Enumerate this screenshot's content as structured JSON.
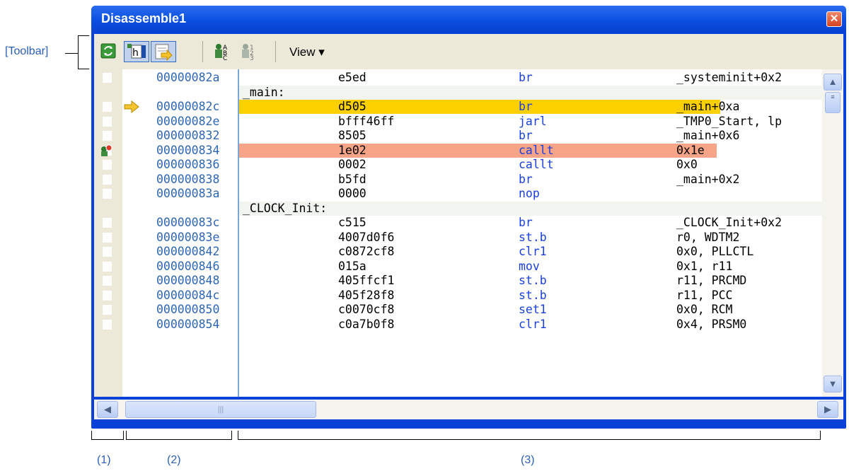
{
  "annotations": {
    "toolbar_label": "[Toolbar]",
    "area1": "(1)",
    "area2": "(2)",
    "area3": "(3)"
  },
  "window": {
    "title": "Disassemble1",
    "close_glyph": "✕"
  },
  "toolbar": {
    "buttons": [
      {
        "icon": "refresh-icon",
        "pressed": false
      },
      {
        "icon": "mixed-display-icon",
        "pressed": true
      },
      {
        "icon": "go-to-pc-icon",
        "pressed": true
      },
      {
        "icon": "symbol-display-icon",
        "pressed": false
      },
      {
        "icon": "number-display-icon",
        "pressed": false
      }
    ],
    "view_label": "View",
    "view_arrow": "▾"
  },
  "listing": {
    "rows": [
      {
        "type": "code",
        "address": "00000082a",
        "code": "e5ed",
        "mnemonic": "br",
        "operand": "_systeminit+0x2"
      },
      {
        "type": "label",
        "text": "_main:"
      },
      {
        "type": "code",
        "address": "00000082c",
        "code": "d505",
        "mnemonic": "br",
        "operand": "_main+0xa",
        "highlight": "pc"
      },
      {
        "type": "code",
        "address": "00000082e",
        "code": "bfff46ff",
        "mnemonic": "jarl",
        "operand": "_TMP0_Start, lp"
      },
      {
        "type": "code",
        "address": "000000832",
        "code": "8505",
        "mnemonic": "br",
        "operand": "_main+0x6"
      },
      {
        "type": "code",
        "address": "000000834",
        "code": "1e02",
        "mnemonic": "callt",
        "operand": "0x1e",
        "highlight": "break"
      },
      {
        "type": "code",
        "address": "000000836",
        "code": "0002",
        "mnemonic": "callt",
        "operand": "0x0"
      },
      {
        "type": "code",
        "address": "000000838",
        "code": "b5fd",
        "mnemonic": "br",
        "operand": "_main+0x2"
      },
      {
        "type": "code",
        "address": "00000083a",
        "code": "0000",
        "mnemonic": "nop",
        "operand": ""
      },
      {
        "type": "label",
        "text": "_CLOCK_Init:"
      },
      {
        "type": "code",
        "address": "00000083c",
        "code": "c515",
        "mnemonic": "br",
        "operand": "_CLOCK_Init+0x2"
      },
      {
        "type": "code",
        "address": "00000083e",
        "code": "4007d0f6",
        "mnemonic": "st.b",
        "operand": "r0, WDTM2"
      },
      {
        "type": "code",
        "address": "000000842",
        "code": "c0872cf8",
        "mnemonic": "clr1",
        "operand": "0x0, PLLCTL"
      },
      {
        "type": "code",
        "address": "000000846",
        "code": "015a",
        "mnemonic": "mov",
        "operand": "0x1, r11"
      },
      {
        "type": "code",
        "address": "000000848",
        "code": "405ffcf1",
        "mnemonic": "st.b",
        "operand": "r11, PRCMD"
      },
      {
        "type": "code",
        "address": "00000084c",
        "code": "405f28f8",
        "mnemonic": "st.b",
        "operand": "r11, PCC"
      },
      {
        "type": "code",
        "address": "000000850",
        "code": "c0070cf8",
        "mnemonic": "set1",
        "operand": "0x0, RCM"
      },
      {
        "type": "code",
        "address": "000000854",
        "code": "c0a7b0f8",
        "mnemonic": "clr1",
        "operand": "0x4, PRSM0"
      }
    ]
  },
  "scrollbars": {
    "up": "▲",
    "down": "▼",
    "left": "◀",
    "right": "▶",
    "thumb_grip": "|||"
  },
  "colors": {
    "pc_highlight": "#fdd000",
    "breakpoint_highlight": "#f7a488",
    "mnemonic": "#1a3fdc",
    "address": "#2f66b3"
  }
}
